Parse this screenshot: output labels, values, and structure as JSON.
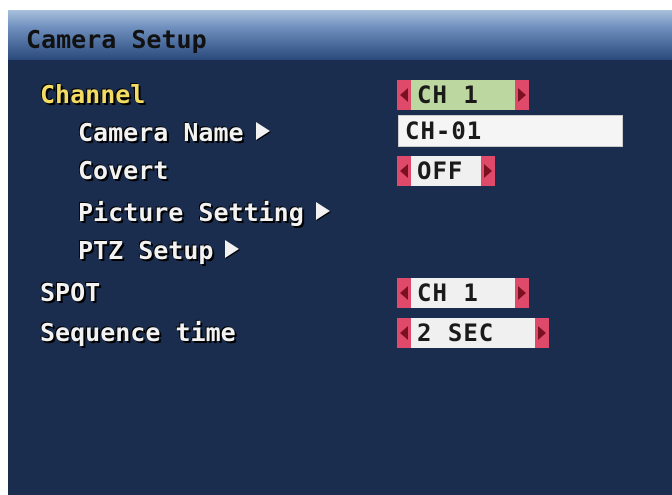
{
  "window": {
    "title": "Camera Setup"
  },
  "menu": {
    "channel": {
      "label": "Channel",
      "value": "CH 1"
    },
    "camera_name": {
      "label": "Camera Name",
      "value": "CH-01"
    },
    "covert": {
      "label": "Covert",
      "value": "OFF"
    },
    "picture_setting": {
      "label": "Picture Setting"
    },
    "ptz_setup": {
      "label": "PTZ Setup"
    },
    "spot": {
      "label": "SPOT",
      "value": "CH 1"
    },
    "sequence_time": {
      "label": "Sequence time",
      "value": "2 SEC"
    }
  },
  "colors": {
    "background": "#1a2d4f",
    "selected_label": "#f3dc63",
    "spinner_arrow": "#e04a6a",
    "active_value": "#bcd7a0"
  },
  "icons": [
    "arrow-right-icon",
    "spin-left-icon",
    "spin-right-icon"
  ]
}
